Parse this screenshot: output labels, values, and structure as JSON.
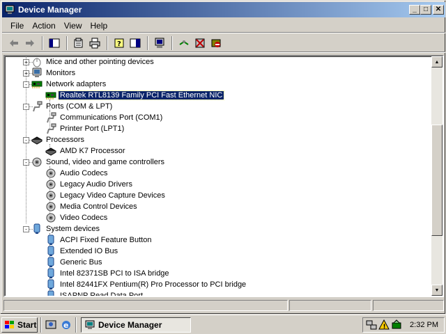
{
  "window": {
    "title": "Device Manager"
  },
  "menu": [
    "File",
    "Action",
    "View",
    "Help"
  ],
  "toolbar_icons": [
    "back-icon",
    "forward-icon",
    "console-tree-icon",
    "properties-icon",
    "print-icon",
    "help-icon",
    "show-hide-icon",
    "computer-icon",
    "scan-hardware-icon",
    "uninstall-icon",
    "disable-icon"
  ],
  "tree": [
    {
      "label": "Mice and other pointing devices",
      "level": 0,
      "expander": "+",
      "icon": "mouse-icon"
    },
    {
      "label": "Monitors",
      "level": 0,
      "expander": "+",
      "icon": "monitor-icon"
    },
    {
      "label": "Network adapters",
      "level": 0,
      "expander": "-",
      "icon": "network-card-icon"
    },
    {
      "label": "Realtek RTL8139 Family PCI Fast Ethernet NIC",
      "level": 1,
      "icon": "network-card-icon",
      "selected": true
    },
    {
      "label": "Ports (COM & LPT)",
      "level": 0,
      "expander": "-",
      "icon": "port-icon"
    },
    {
      "label": "Communications Port (COM1)",
      "level": 1,
      "icon": "port-icon"
    },
    {
      "label": "Printer Port (LPT1)",
      "level": 1,
      "icon": "port-icon"
    },
    {
      "label": "Processors",
      "level": 0,
      "expander": "-",
      "icon": "processor-icon"
    },
    {
      "label": "AMD K7 Processor",
      "level": 1,
      "icon": "processor-icon"
    },
    {
      "label": "Sound, video and game controllers",
      "level": 0,
      "expander": "-",
      "icon": "sound-icon"
    },
    {
      "label": "Audio Codecs",
      "level": 1,
      "icon": "sound-icon"
    },
    {
      "label": "Legacy Audio Drivers",
      "level": 1,
      "icon": "sound-icon"
    },
    {
      "label": "Legacy Video Capture Devices",
      "level": 1,
      "icon": "sound-icon"
    },
    {
      "label": "Media Control Devices",
      "level": 1,
      "icon": "sound-icon"
    },
    {
      "label": "Video Codecs",
      "level": 1,
      "icon": "sound-icon"
    },
    {
      "label": "System devices",
      "level": 0,
      "expander": "-",
      "icon": "system-device-icon"
    },
    {
      "label": "ACPI Fixed Feature Button",
      "level": 1,
      "icon": "system-device-icon"
    },
    {
      "label": "Extended IO Bus",
      "level": 1,
      "icon": "system-device-icon"
    },
    {
      "label": "Generic Bus",
      "level": 1,
      "icon": "system-device-icon"
    },
    {
      "label": "Intel 82371SB PCI to ISA bridge",
      "level": 1,
      "icon": "system-device-icon"
    },
    {
      "label": "Intel 82441FX Pentium(R) Pro Processor to PCI bridge",
      "level": 1,
      "icon": "system-device-icon"
    },
    {
      "label": "ISAPNP Read Data Port",
      "level": 1,
      "icon": "system-device-icon"
    }
  ],
  "taskbar": {
    "start_label": "Start",
    "task_label": "Device Manager",
    "clock": "2:32 PM"
  },
  "colors": {
    "titlebar": "#0a246a",
    "selection": "#0a246a",
    "face": "#d4d0c8"
  }
}
